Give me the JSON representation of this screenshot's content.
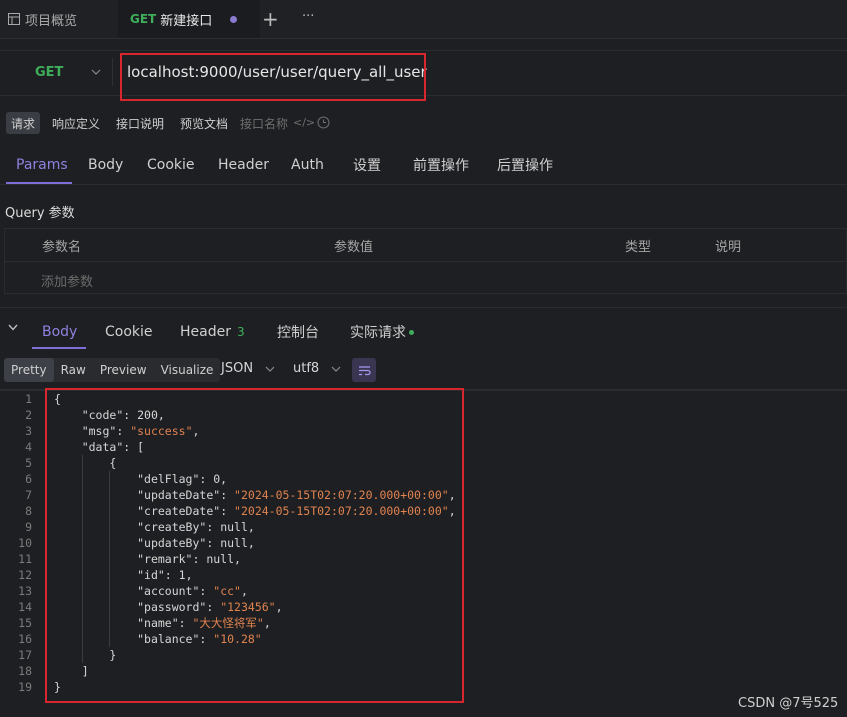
{
  "tabs": {
    "overview_label": "项目概览",
    "new_method": "GET",
    "new_label": "新建接口",
    "add": "+",
    "more": "···"
  },
  "request": {
    "method": "GET",
    "url": "localhost:9000/user/user/query_all_user"
  },
  "segments": [
    "请求",
    "响应定义",
    "接口说明",
    "预览文档"
  ],
  "name_placeholder": "接口名称",
  "param_tabs": [
    "Params",
    "Body",
    "Cookie",
    "Header",
    "Auth",
    "设置",
    "前置操作",
    "后置操作"
  ],
  "query": {
    "title": "Query 参数",
    "columns": [
      "参数名",
      "参数值",
      "类型",
      "说明"
    ],
    "add_placeholder": "添加参数"
  },
  "response_tabs": {
    "body": "Body",
    "cookie": "Cookie",
    "header": "Header",
    "header_count": "3",
    "console": "控制台",
    "actual": "实际请求"
  },
  "format": {
    "modes": [
      "Pretty",
      "Raw",
      "Preview",
      "Visualize"
    ],
    "type": "JSON",
    "encoding": "utf8"
  },
  "code_lines": [
    "{",
    "    \"code\": 200,",
    "    \"msg\": \"success\",",
    "    \"data\": [",
    "        {",
    "            \"delFlag\": 0,",
    "            \"updateDate\": \"2024-05-15T02:07:20.000+00:00\",",
    "            \"createDate\": \"2024-05-15T02:07:20.000+00:00\",",
    "            \"createBy\": null,",
    "            \"updateBy\": null,",
    "            \"remark\": null,",
    "            \"id\": 1,",
    "            \"account\": \"cc\",",
    "            \"password\": \"123456\",",
    "            \"name\": \"大大怪将军\",",
    "            \"balance\": \"10.28\"",
    "        }",
    "    ]",
    "}"
  ],
  "watermark": "CSDN @7号525",
  "colors": {
    "accent": "#8e82e0",
    "get_green": "#3fae5b",
    "highlight_red": "#d8262f",
    "string_orange": "#e0834f"
  }
}
